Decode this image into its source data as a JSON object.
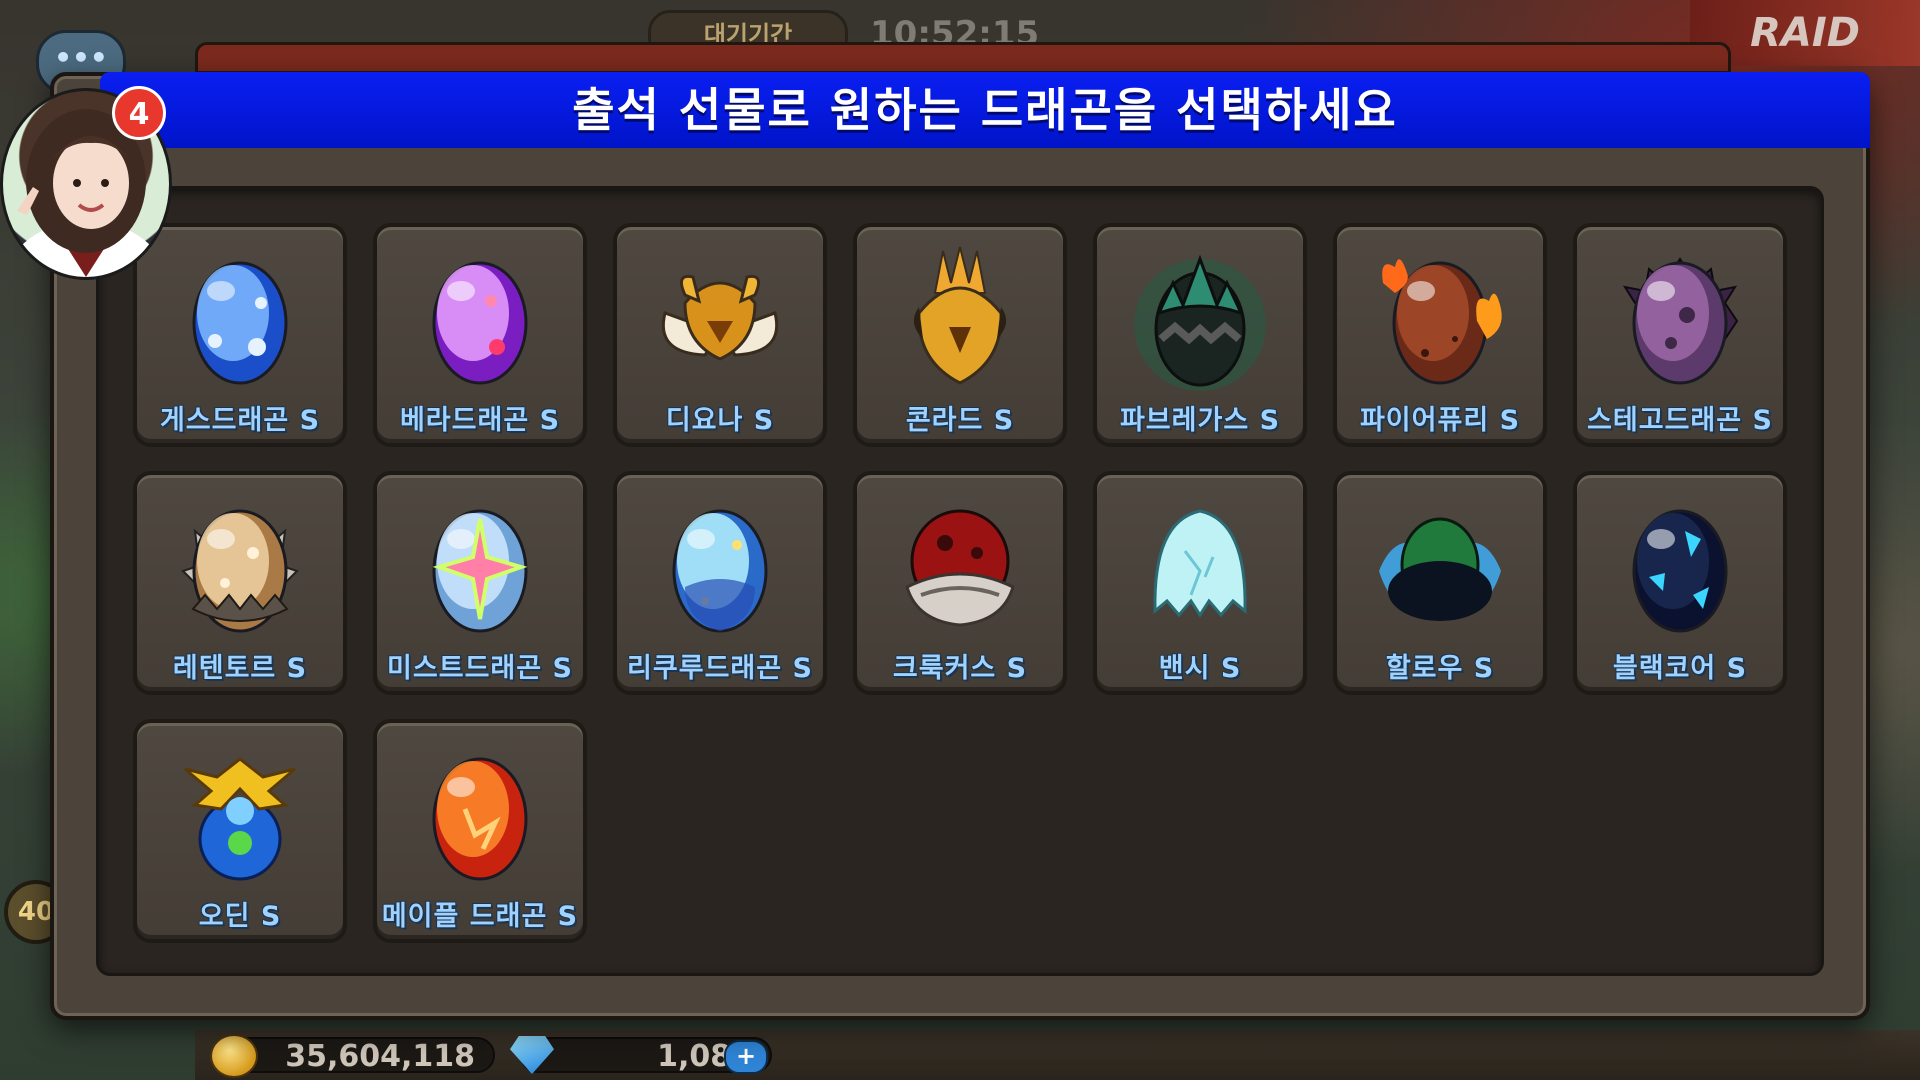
{
  "background": {
    "wait_tab": "대기기간",
    "timer": "10:52:15",
    "raid_label": "RAID",
    "chat_icon": "•••",
    "level": "40",
    "currency": {
      "gold": "35,604,118",
      "gems": "1,080",
      "plus": "+"
    }
  },
  "notification": {
    "count": "4"
  },
  "modal": {
    "title": "출석 선물로 원하는 드래곤을 선택하세요",
    "dragons": [
      {
        "label": "게스드래곤 S",
        "icon": "blue-egg"
      },
      {
        "label": "베라드래곤 S",
        "icon": "purple-egg"
      },
      {
        "label": "디요나 S",
        "icon": "winged-gold-helm"
      },
      {
        "label": "콘라드 S",
        "icon": "flaming-gold-helm"
      },
      {
        "label": "파브레가스 S",
        "icon": "green-spiked-egg"
      },
      {
        "label": "파이어퓨리 S",
        "icon": "fire-egg"
      },
      {
        "label": "스테고드래곤 S",
        "icon": "stego-egg"
      },
      {
        "label": "레텐토르 S",
        "icon": "tan-spiked-egg"
      },
      {
        "label": "미스트드래곤 S",
        "icon": "mist-egg"
      },
      {
        "label": "리쿠루드래곤 S",
        "icon": "aqua-egg"
      },
      {
        "label": "크룩커스 S",
        "icon": "red-winged-egg"
      },
      {
        "label": "밴시 S",
        "icon": "ghost-egg"
      },
      {
        "label": "할로우 S",
        "icon": "hollow-egg"
      },
      {
        "label": "블랙코어 S",
        "icon": "blackcore-egg"
      },
      {
        "label": "오딘 S",
        "icon": "odin-helm"
      },
      {
        "label": "메이플 드래곤 S",
        "icon": "maple-egg"
      }
    ]
  },
  "colors": {
    "title_bar": "#0a1ff2",
    "label_text": "#9fd2ff",
    "card_bg": "#4a433b"
  }
}
